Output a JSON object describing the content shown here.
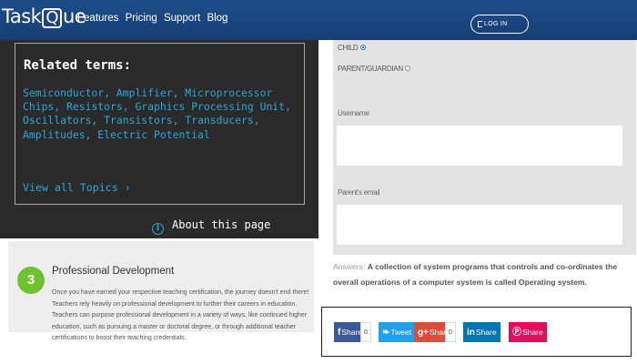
{
  "header": {
    "logo_pre": "Task",
    "logo_q": "Q",
    "logo_post": "ue",
    "nav": [
      "Features",
      "Pricing",
      "Support",
      "Blog"
    ],
    "login_label": "LOG IN"
  },
  "related": {
    "title": "Related terms:",
    "links_text": "Semiconductor, Amplifier, Microprocessor Chips, Resistors, Graphics Processing Unit, Oscillators, Transistors, Transducers, Amplitudes, Electric Potential",
    "view_all": "View all Topics ›",
    "about": "About this page"
  },
  "professional": {
    "number": "3",
    "title": "Professional Development",
    "body": "Once you have earned your respective teaching certification, the journey doesn't end there! Teachers rely heavily on professional development to further their careers in education. Teachers can purpose professional development in a variety of ways, like continued higher education, such as pursuing a master or doctoral degree, or through additional teacher certifications to boost their teaching credentials."
  },
  "form": {
    "child_label": "CHILD",
    "parent_label": "PARENT/GUARDIAN",
    "username_label": "Username",
    "parent_email_label": "Parent's email"
  },
  "answer": {
    "label": "Answers:",
    "text": "A collection of system programs that controls and co-ordinates the overall operations of a computer system is called Operating system."
  },
  "share": {
    "facebook_label": "Share",
    "facebook_count": "0",
    "twitter_label": "Tweet",
    "google_label": "Share",
    "google_count": "0",
    "linkedin_label": "Share",
    "pinterest_label": "Share",
    "colors": {
      "facebook": "#3b5998",
      "twitter": "#1da1f2",
      "google": "#dd4b39",
      "linkedin": "#0077b5",
      "pinterest": "#e60c5c"
    }
  }
}
